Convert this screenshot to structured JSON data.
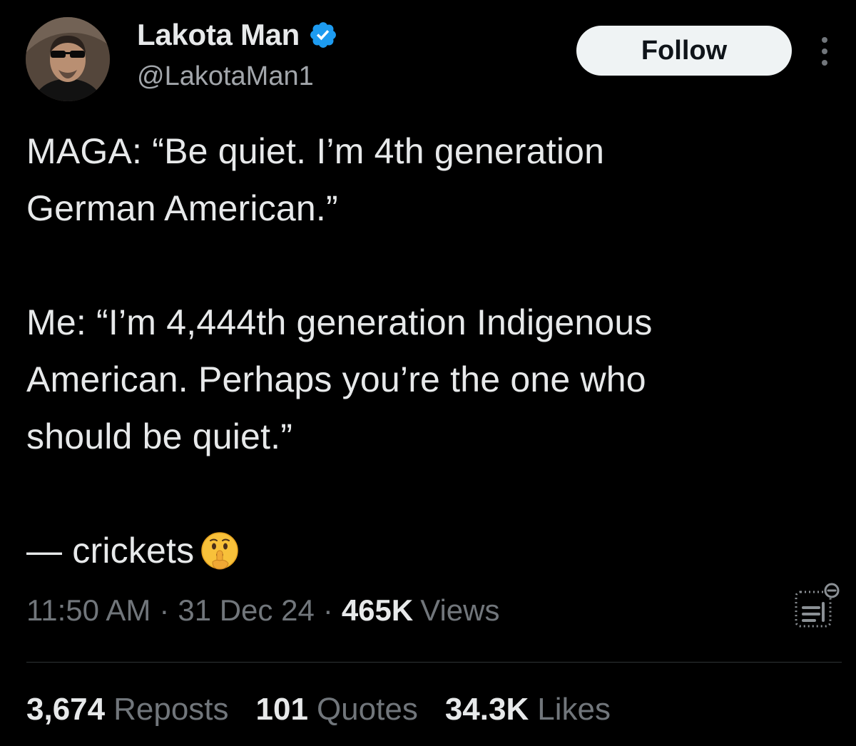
{
  "author": {
    "display_name": "Lakota Man",
    "handle": "@LakotaMan1",
    "verified": true,
    "verified_color": "#1d9bf0",
    "avatar_icon": "profile-photo"
  },
  "actions": {
    "follow_label": "Follow",
    "more_icon": "more-dots-vertical-icon"
  },
  "tweet": {
    "lines": [
      "MAGA: “Be quiet. I’m 4th generation",
      "German American.”",
      "Me: “I’m 4,444th generation Indigenous",
      "American. Perhaps you’re the one who",
      "should be quiet.”",
      "— crickets"
    ],
    "emoji": "🤫",
    "emoji_name": "shushing-face-icon"
  },
  "meta": {
    "time": "11:50 AM",
    "separator": "·",
    "date": "31 Dec 24",
    "views_count": "465K",
    "views_label": "Views",
    "analytics_icon": "analytics-icon"
  },
  "stats": {
    "reposts_count": "3,674",
    "reposts_label": "Reposts",
    "quotes_count": "101",
    "quotes_label": "Quotes",
    "likes_count": "34.3K",
    "likes_label": "Likes"
  },
  "colors": {
    "background": "#000000",
    "primary_text": "#e7e9ea",
    "secondary_text": "#71767b",
    "follow_bg": "#eff3f4",
    "divider": "#2f3336"
  }
}
